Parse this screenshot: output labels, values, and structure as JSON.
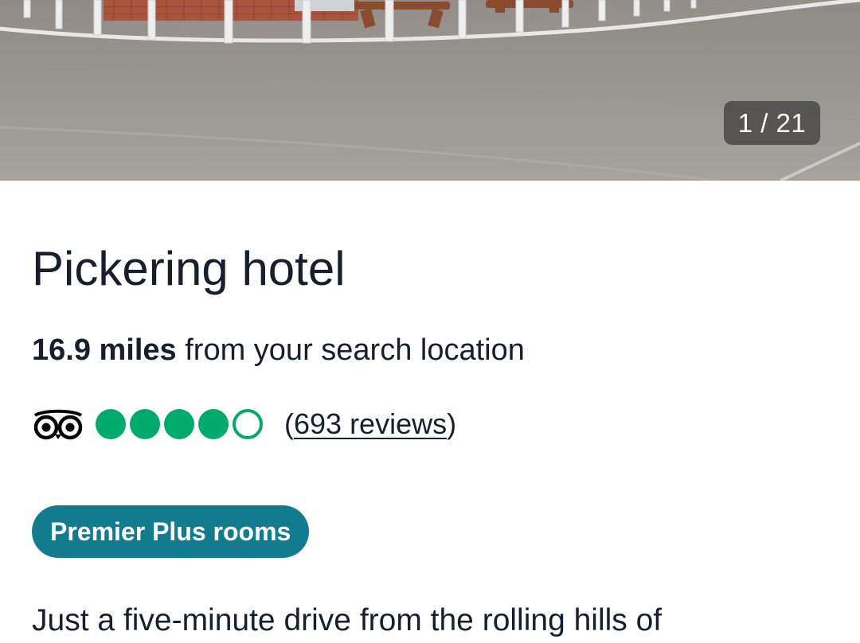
{
  "gallery": {
    "counter_text": "1 / 21",
    "current": 1,
    "total": 21
  },
  "hotel": {
    "name": "Pickering hotel",
    "distance_value": "16.9 miles",
    "distance_suffix": " from your search location"
  },
  "rating": {
    "provider_icon": "tripadvisor-owl-icon",
    "bubbles_filled": 4,
    "bubbles_total": 5,
    "open_paren": "(",
    "reviews_text": "693 reviews",
    "close_paren": ")",
    "accent_color": "#00aa6c"
  },
  "badge": {
    "label": "Premier Plus rooms",
    "color": "#127c8e"
  },
  "description": {
    "text": "Just a five-minute drive from the rolling hills of"
  }
}
